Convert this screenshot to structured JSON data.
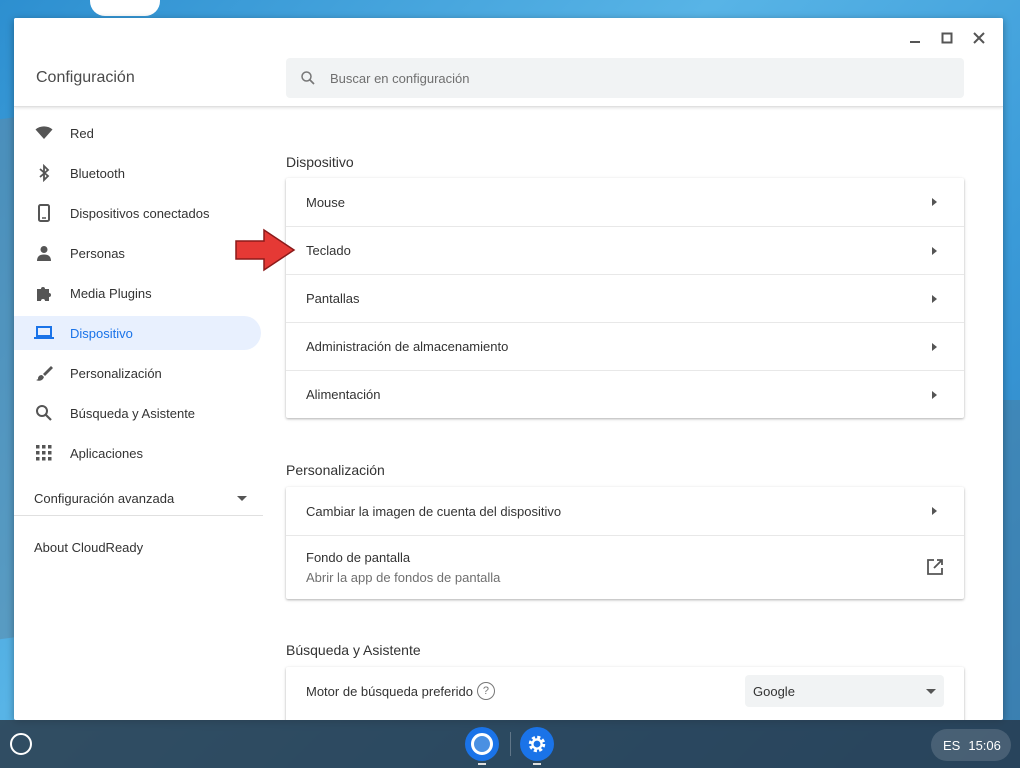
{
  "window": {
    "title": "Configuración",
    "search_placeholder": "Buscar en configuración"
  },
  "sidebar": {
    "items": [
      {
        "label": "Red",
        "icon": "wifi-icon"
      },
      {
        "label": "Bluetooth",
        "icon": "bluetooth-icon"
      },
      {
        "label": "Dispositivos conectados",
        "icon": "phone-icon"
      },
      {
        "label": "Personas",
        "icon": "person-icon"
      },
      {
        "label": "Media Plugins",
        "icon": "puzzle-icon"
      },
      {
        "label": "Dispositivo",
        "icon": "laptop-icon",
        "active": true
      },
      {
        "label": "Personalización",
        "icon": "brush-icon"
      },
      {
        "label": "Búsqueda y Asistente",
        "icon": "search-icon"
      },
      {
        "label": "Aplicaciones",
        "icon": "apps-grid-icon"
      }
    ],
    "advanced_label": "Configuración avanzada",
    "about_label": "About CloudReady"
  },
  "sections": {
    "device": {
      "title": "Dispositivo",
      "rows": [
        "Mouse",
        "Teclado",
        "Pantallas",
        "Administración de almacenamiento",
        "Alimentación"
      ]
    },
    "personalization": {
      "title": "Personalización",
      "change_image": "Cambiar la imagen de cuenta del dispositivo",
      "wallpaper_title": "Fondo de pantalla",
      "wallpaper_sub": "Abrir la app de fondos de pantalla"
    },
    "search": {
      "title": "Búsqueda y Asistente",
      "engine_label": "Motor de búsqueda preferido",
      "engine_value": "Google"
    }
  },
  "shelf": {
    "ime": "ES",
    "time": "15:06"
  },
  "colors": {
    "accent": "#1a73e8",
    "active_bg": "#e8f0fe",
    "annotation_arrow": "#e53935"
  }
}
